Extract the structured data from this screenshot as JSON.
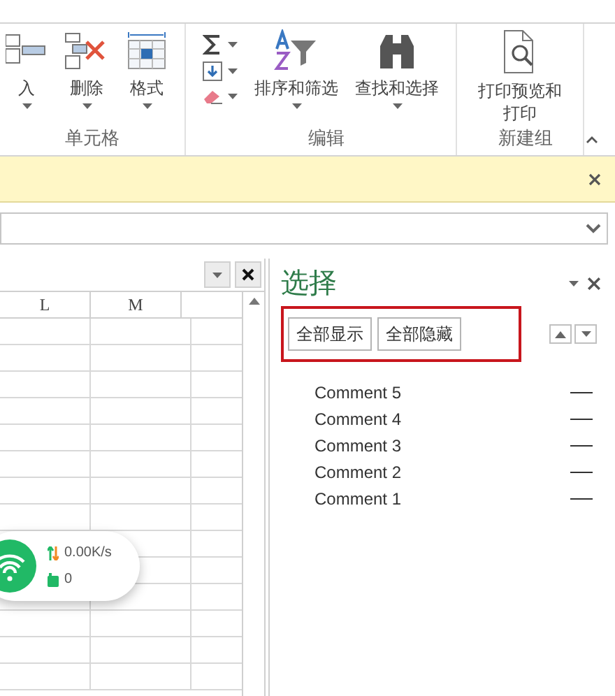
{
  "ribbon": {
    "groups": [
      {
        "label": "单元格",
        "items": [
          {
            "kind": "large",
            "label": "入"
          },
          {
            "kind": "large",
            "label": "删除"
          },
          {
            "kind": "large",
            "label": "格式"
          }
        ]
      },
      {
        "label": "编辑",
        "items": [
          {
            "kind": "stack"
          },
          {
            "kind": "large",
            "label": "排序和筛选"
          },
          {
            "kind": "large",
            "label": "查找和选择"
          }
        ]
      },
      {
        "label": "新建组",
        "items": [
          {
            "kind": "large",
            "label": "打印预览和打印",
            "dropdown": false
          }
        ]
      }
    ]
  },
  "sheet": {
    "columns": [
      "L",
      "M"
    ]
  },
  "pane": {
    "title": "选择",
    "buttons": [
      "全部显示",
      "全部隐藏"
    ],
    "items": [
      {
        "name": "Comment 5"
      },
      {
        "name": "Comment 4"
      },
      {
        "name": "Comment 3"
      },
      {
        "name": "Comment 2"
      },
      {
        "name": "Comment 1"
      }
    ]
  },
  "widget": {
    "speed": "0.00K/s",
    "count": "0"
  }
}
